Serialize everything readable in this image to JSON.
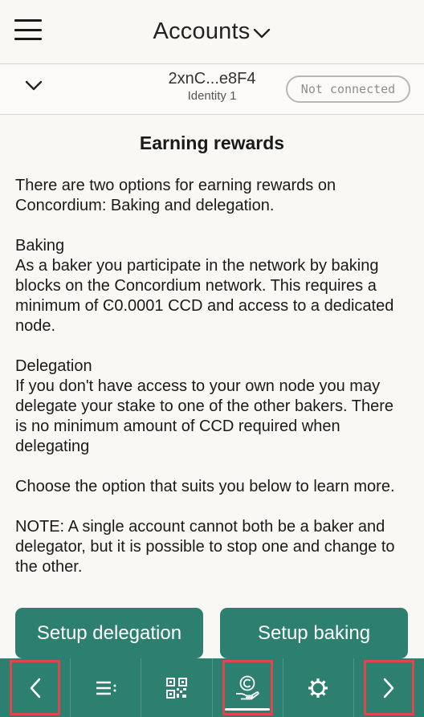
{
  "header": {
    "title": "Accounts",
    "menu_icon": "hamburger-menu-icon",
    "title_icon": "chevron-down-icon"
  },
  "account_bar": {
    "address": "2xnC...e8F4",
    "identity": "Identity 1",
    "status": "Not connected",
    "expand_icon": "chevron-down-icon"
  },
  "content": {
    "heading": "Earning rewards",
    "intro": "There are two options for earning rewards on Concordium: Baking and delegation.",
    "baking_title": "Baking",
    "baking_text": "As a baker you participate in the network by baking blocks on the Concordium network. This requires a minimum of Ͼ0.0001 CCD and access to a dedicated node.",
    "delegation_title": "Delegation",
    "delegation_text": "If you don't have access to your own node you may delegate your stake to one of the other bakers. There is no minimum amount of CCD required when delegating",
    "choose_text": "Choose the option that suits you below to learn more.",
    "note_text": "NOTE: A single account cannot both be a baker and delegator, but it is possible to stop one and change to the other."
  },
  "buttons": {
    "setup_delegation": "Setup delegation",
    "setup_baking": "Setup baking"
  },
  "bottom_nav": {
    "items": [
      {
        "icon": "back-arrow-icon"
      },
      {
        "icon": "transaction-list-icon"
      },
      {
        "icon": "qr-code-icon"
      },
      {
        "icon": "earn-rewards-icon",
        "active": true
      },
      {
        "icon": "settings-gear-icon"
      },
      {
        "icon": "forward-arrow-icon"
      }
    ]
  },
  "colors": {
    "accent": "#2d7f70",
    "background": "#f9f8f5",
    "highlight_box": "#e0474c",
    "status_border": "#b7b7b7"
  }
}
